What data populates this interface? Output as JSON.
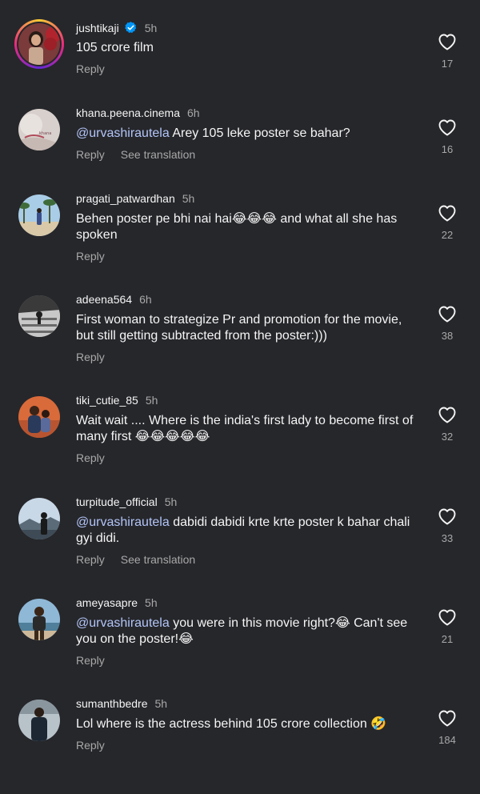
{
  "comments": [
    {
      "username": "jushtikaji",
      "verified": true,
      "time": "5h",
      "mention": "",
      "text": "105 crore film",
      "reply": "Reply",
      "see_translation": "",
      "likes": "17"
    },
    {
      "username": "khana.peena.cinema",
      "verified": false,
      "time": "6h",
      "mention": "@urvashirautela",
      "text": " Arey 105 leke poster se bahar?",
      "reply": "Reply",
      "see_translation": "See translation",
      "likes": "16"
    },
    {
      "username": "pragati_patwardhan",
      "verified": false,
      "time": "5h",
      "mention": "",
      "text": "Behen poster pe bhi nai hai😂😂😂 and what all she has spoken",
      "reply": "Reply",
      "see_translation": "",
      "likes": "22"
    },
    {
      "username": "adeena564",
      "verified": false,
      "time": "6h",
      "mention": "",
      "text": "First woman to strategize Pr and promotion for the movie, but still getting subtracted from the poster:)))",
      "reply": "Reply",
      "see_translation": "",
      "likes": "38"
    },
    {
      "username": "tiki_cutie_85",
      "verified": false,
      "time": "5h",
      "mention": "",
      "text": "Wait wait .... Where is the india's first lady to become first of many first 😂😂😂😂😂",
      "reply": "Reply",
      "see_translation": "",
      "likes": "32"
    },
    {
      "username": "turpitude_official",
      "verified": false,
      "time": "5h",
      "mention": "@urvashirautela",
      "text": " dabidi dabidi krte krte poster k bahar chali gyi didi.",
      "reply": "Reply",
      "see_translation": "See translation",
      "likes": "33"
    },
    {
      "username": "ameyasapre",
      "verified": false,
      "time": "5h",
      "mention": "@urvashirautela",
      "text": " you were in this movie right?😂 Can't see you on the poster!😂",
      "reply": "Reply",
      "see_translation": "",
      "likes": "21"
    },
    {
      "username": "sumanthbedre",
      "verified": false,
      "time": "5h",
      "mention": "",
      "text": "Lol where is the actress behind 105 crore collection 🤣",
      "reply": "Reply",
      "see_translation": "",
      "likes": "184"
    }
  ],
  "icons": {
    "like": "heart-outline-icon",
    "verified": "verified-badge-icon"
  },
  "colors": {
    "background": "#26272b",
    "text": "#f5f5f5",
    "secondary_text": "#a8a8a8",
    "mention": "#b3c5f8",
    "verified": "#0095f6"
  }
}
